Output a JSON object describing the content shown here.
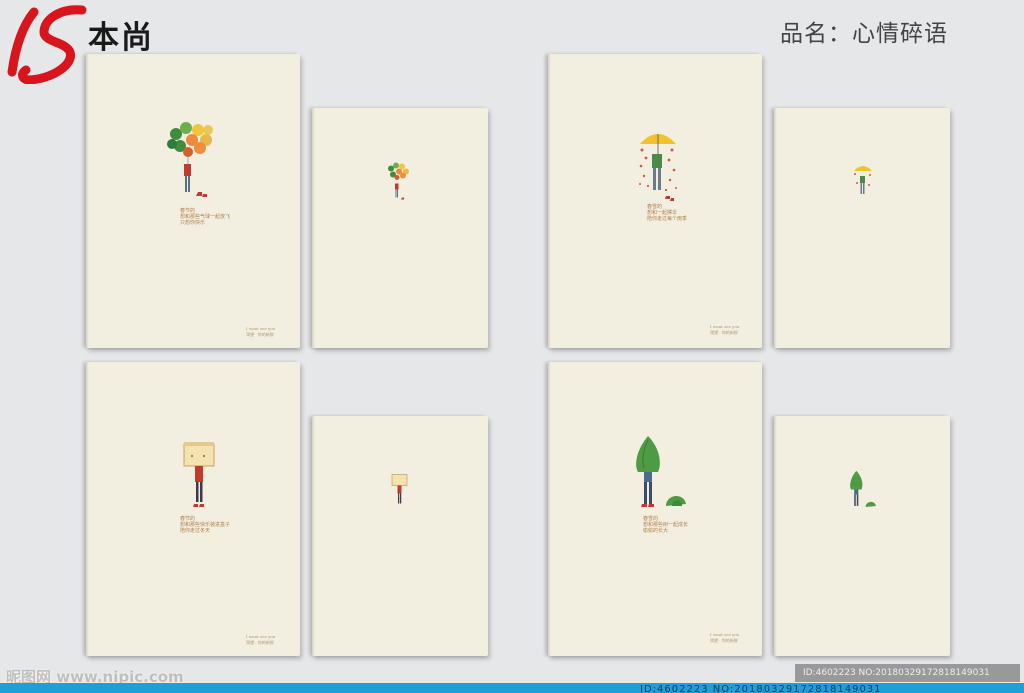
{
  "brand": {
    "name": "本尚"
  },
  "product": {
    "label": "品名：心情碎语"
  },
  "books": {
    "balloons": {
      "caption": "春节的\n想和那些气球一起放飞\n只想你快乐",
      "footer": "I want see you\n渴望 · 你的新鲜"
    },
    "umbrella": {
      "caption": "春雪的\n想和一起撑伞\n陪你走过每个雨季",
      "footer": "I want see you\n渴望 · 你的新鲜"
    },
    "box": {
      "caption": "春节的\n想和那些快乐装进盒子\n陪你走过冬天",
      "footer": "I want see you\n渴望 · 你的新鲜"
    },
    "tree": {
      "caption": "春雪的\n想和那些树一起成长\n偷偷的长大",
      "footer": "I want see you\n渴望 · 你的新鲜"
    }
  },
  "watermark": {
    "text": "昵图网 www.nipic.com"
  },
  "image_id": {
    "text": "ID:4602223 NO:20180329172818149031"
  },
  "bottom_strip": {
    "text": "ID:4602223 NO:20180329172818149031"
  }
}
